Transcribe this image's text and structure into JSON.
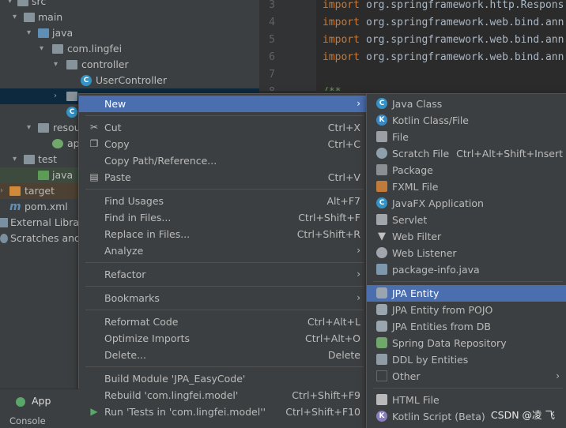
{
  "tree": {
    "items": [
      {
        "label": "src"
      },
      {
        "label": "main"
      },
      {
        "label": "java"
      },
      {
        "label": "com.lingfei"
      },
      {
        "label": "controller"
      },
      {
        "label": "UserController"
      },
      {
        "label": ""
      },
      {
        "label": ""
      },
      {
        "label": "resou"
      },
      {
        "label": "ap"
      },
      {
        "label": "test"
      },
      {
        "label": "java"
      },
      {
        "label": "target"
      },
      {
        "label": "pom.xml"
      },
      {
        "label": "External Librar"
      },
      {
        "label": "Scratches and"
      }
    ]
  },
  "editor": {
    "lines": [
      {
        "num": "3",
        "keyword": "import",
        "text": "org.springframework.http.Respons"
      },
      {
        "num": "4",
        "keyword": "import",
        "text": "org.springframework.web.bind.ann"
      },
      {
        "num": "5",
        "keyword": "import",
        "text": "org.springframework.web.bind.ann"
      },
      {
        "num": "6",
        "keyword": "import",
        "text": "org.springframework.web.bind.ann"
      },
      {
        "num": "7",
        "keyword": "",
        "text": ""
      },
      {
        "num": "8",
        "keyword": "",
        "text": "/**"
      }
    ]
  },
  "context_menu": {
    "items": [
      {
        "label": "New",
        "shortcut": "",
        "arrow": "›"
      },
      {
        "label": "Cut",
        "shortcut": "Ctrl+X",
        "arrow": ""
      },
      {
        "label": "Copy",
        "shortcut": "Ctrl+C",
        "arrow": ""
      },
      {
        "label": "Copy Path/Reference...",
        "shortcut": "",
        "arrow": ""
      },
      {
        "label": "Paste",
        "shortcut": "Ctrl+V",
        "arrow": ""
      },
      {
        "label": "Find Usages",
        "shortcut": "Alt+F7",
        "arrow": ""
      },
      {
        "label": "Find in Files...",
        "shortcut": "Ctrl+Shift+F",
        "arrow": ""
      },
      {
        "label": "Replace in Files...",
        "shortcut": "Ctrl+Shift+R",
        "arrow": ""
      },
      {
        "label": "Analyze",
        "shortcut": "",
        "arrow": "›"
      },
      {
        "label": "Refactor",
        "shortcut": "",
        "arrow": "›"
      },
      {
        "label": "Bookmarks",
        "shortcut": "",
        "arrow": "›"
      },
      {
        "label": "Reformat Code",
        "shortcut": "Ctrl+Alt+L",
        "arrow": ""
      },
      {
        "label": "Optimize Imports",
        "shortcut": "Ctrl+Alt+O",
        "arrow": ""
      },
      {
        "label": "Delete...",
        "shortcut": "Delete",
        "arrow": ""
      },
      {
        "label": "Build Module 'JPA_EasyCode'",
        "shortcut": "",
        "arrow": ""
      },
      {
        "label": "Rebuild 'com.lingfei.model'",
        "shortcut": "Ctrl+Shift+F9",
        "arrow": ""
      },
      {
        "label": "Run 'Tests in 'com.lingfei.model''",
        "shortcut": "Ctrl+Shift+F10",
        "arrow": ""
      }
    ]
  },
  "submenu": {
    "items": [
      {
        "label": "Java Class",
        "shortcut": "",
        "arrow": ""
      },
      {
        "label": "Kotlin Class/File",
        "shortcut": "",
        "arrow": ""
      },
      {
        "label": "File",
        "shortcut": "",
        "arrow": ""
      },
      {
        "label": "Scratch File",
        "shortcut": "Ctrl+Alt+Shift+Insert",
        "arrow": ""
      },
      {
        "label": "Package",
        "shortcut": "",
        "arrow": ""
      },
      {
        "label": "FXML File",
        "shortcut": "",
        "arrow": ""
      },
      {
        "label": "JavaFX Application",
        "shortcut": "",
        "arrow": ""
      },
      {
        "label": "Servlet",
        "shortcut": "",
        "arrow": ""
      },
      {
        "label": "Web Filter",
        "shortcut": "",
        "arrow": ""
      },
      {
        "label": "Web Listener",
        "shortcut": "",
        "arrow": ""
      },
      {
        "label": "package-info.java",
        "shortcut": "",
        "arrow": ""
      },
      {
        "label": "JPA Entity",
        "shortcut": "",
        "arrow": ""
      },
      {
        "label": "JPA Entity from POJO",
        "shortcut": "",
        "arrow": ""
      },
      {
        "label": "JPA Entities from DB",
        "shortcut": "",
        "arrow": ""
      },
      {
        "label": "Spring Data Repository",
        "shortcut": "",
        "arrow": ""
      },
      {
        "label": "DDL by Entities",
        "shortcut": "",
        "arrow": ""
      },
      {
        "label": "Other",
        "shortcut": "",
        "arrow": "›"
      },
      {
        "label": "HTML File",
        "shortcut": "",
        "arrow": ""
      },
      {
        "label": "Kotlin Script (Beta)",
        "shortcut": "",
        "arrow": ""
      }
    ]
  },
  "bottom_bar": {
    "run_tab": "App",
    "console_tab": "Console"
  },
  "watermark": "CSDN @凌 飞",
  "colors": {
    "selection": "#4b6eaf",
    "menu_bg": "#3c3f41",
    "editor_bg": "#2b2b2b",
    "keyword": "#cc7832"
  }
}
